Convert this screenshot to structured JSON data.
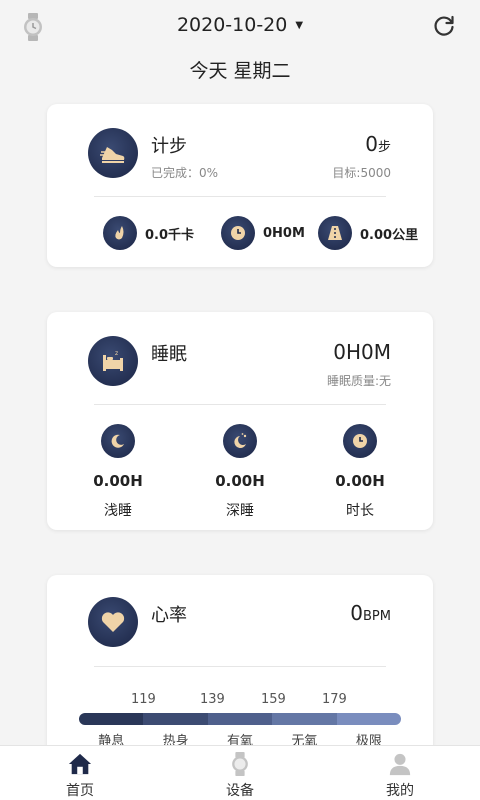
{
  "header": {
    "date": "2020-10-20",
    "day_label": "今天 星期二"
  },
  "steps": {
    "title": "计步",
    "value": "0",
    "unit": "步",
    "completed": "已完成：0%",
    "goal": "目标:5000",
    "calories": "0.0千卡",
    "duration": "0H0M",
    "distance": "0.00公里"
  },
  "sleep": {
    "title": "睡眠",
    "value": "0H0M",
    "quality": "睡眠质量:无",
    "light": {
      "value": "0.00H",
      "label": "浅睡"
    },
    "deep": {
      "value": "0.00H",
      "label": "深睡"
    },
    "total": {
      "value": "0.00H",
      "label": "时长"
    }
  },
  "heart": {
    "title": "心率",
    "value": "0",
    "unit": "BPM",
    "thresholds": [
      "119",
      "139",
      "159",
      "179"
    ],
    "zones": [
      "静息",
      "热身",
      "有氧",
      "无氧",
      "极限"
    ],
    "zone_colors": [
      "#2a3758",
      "#3c4b72",
      "#4f608c",
      "#6477a5",
      "#7a8dbe"
    ]
  },
  "tabs": [
    {
      "label": "首页",
      "icon": "home-icon",
      "active": true
    },
    {
      "label": "设备",
      "icon": "watch-icon",
      "active": false
    },
    {
      "label": "我的",
      "icon": "user-icon",
      "active": false
    }
  ],
  "colors": {
    "accent": "#1f2a4a",
    "icon_gold": "#f0d4a8",
    "inactive": "#c4c4c4"
  }
}
